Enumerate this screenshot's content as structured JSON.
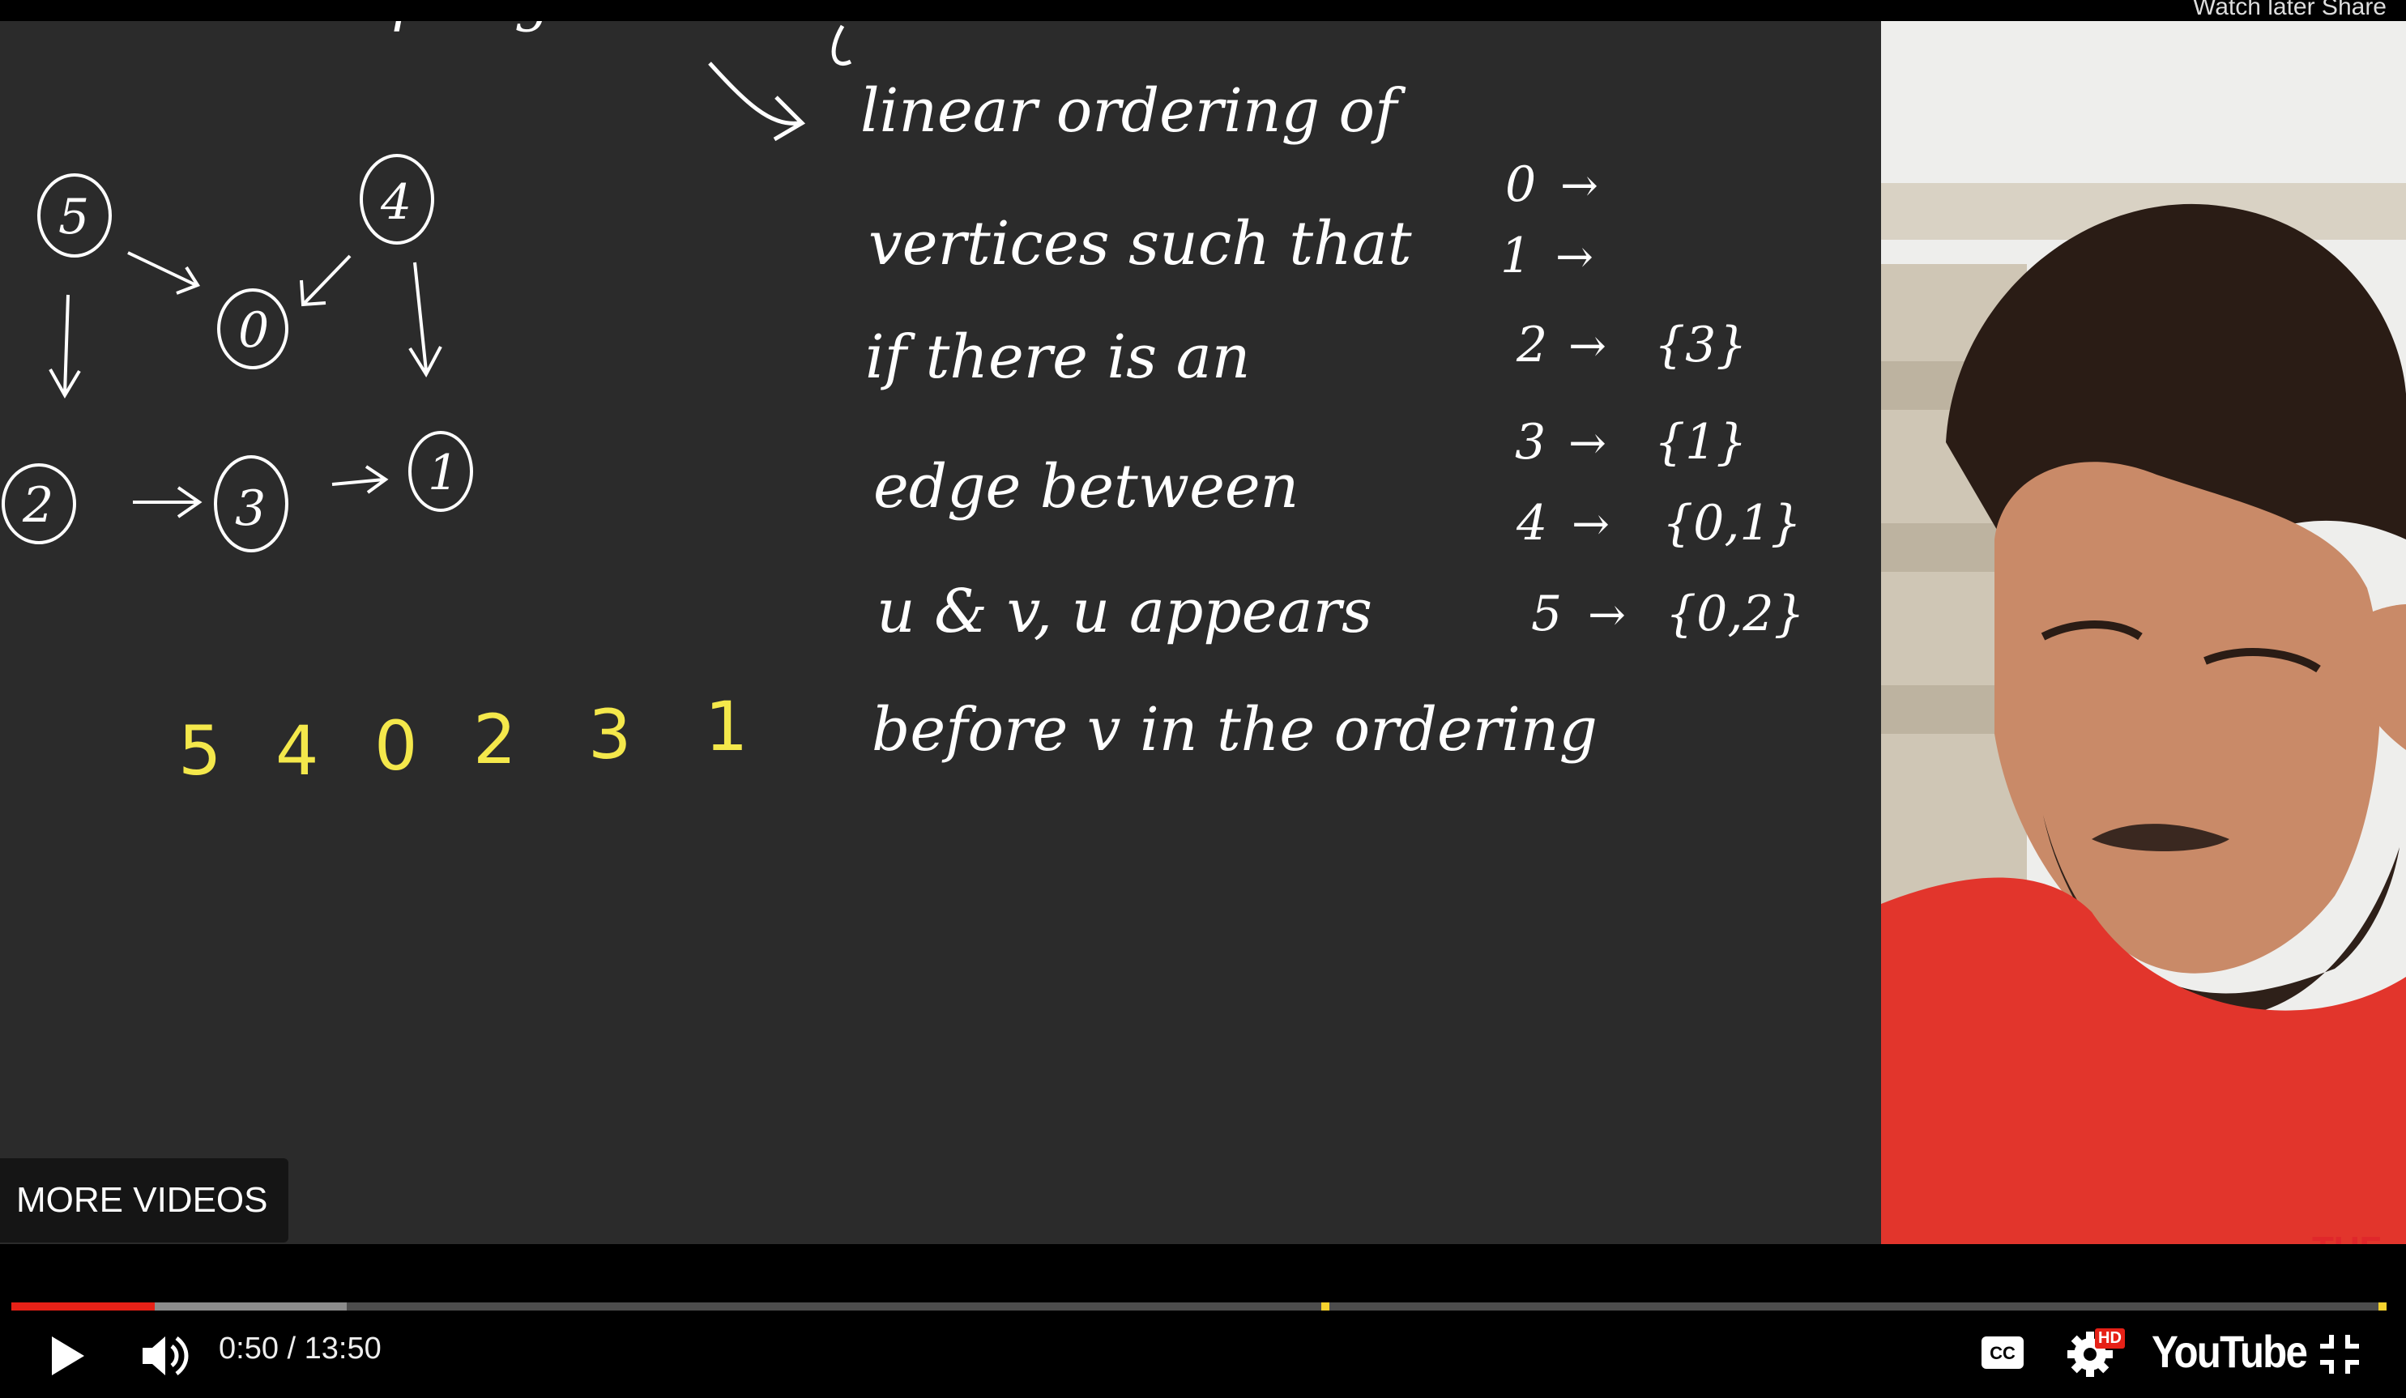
{
  "top_bar": {
    "text": "Watch later   Share"
  },
  "board": {
    "heading_fragment": "Topological Sort",
    "graph_nodes": [
      "5",
      "4",
      "0",
      "2",
      "3",
      "1"
    ],
    "topo_order": [
      "5",
      "4",
      "0",
      "2",
      "3",
      "1"
    ],
    "definition_lines": [
      "linear ordering of",
      "vertices such that",
      "if there is an",
      "edge between",
      "u & v, u appears",
      "before v in the ordering"
    ],
    "adjacency": [
      {
        "vertex": "0",
        "neighbors": ""
      },
      {
        "vertex": "1",
        "neighbors": ""
      },
      {
        "vertex": "2",
        "neighbors": "{3}"
      },
      {
        "vertex": "3",
        "neighbors": "{1}"
      },
      {
        "vertex": "4",
        "neighbors": "{0,1}"
      },
      {
        "vertex": "5",
        "neighbors": "{0,2}"
      }
    ],
    "arrow_glyph": "→"
  },
  "more_videos": {
    "label": "MORE VIDEOS"
  },
  "brand_mark": "TUF",
  "player": {
    "current_time": "0:50",
    "duration": "13:50",
    "time_display": "0:50 / 13:50",
    "played_fraction": 0.0605,
    "buffered_fraction": 0.1414,
    "chapter_marker_fractions": [
      0.5525,
      0.9986
    ],
    "logo_text": "YouTube",
    "hd_badge": "HD",
    "accent_color": "#e62117"
  }
}
